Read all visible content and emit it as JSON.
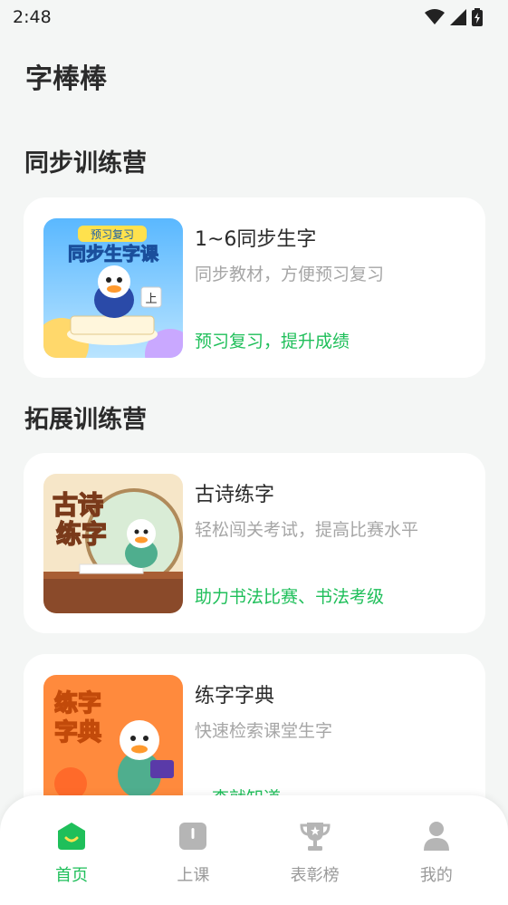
{
  "status_bar": {
    "time": "2:48"
  },
  "app": {
    "title": "字棒棒"
  },
  "sections": [
    {
      "title": "同步训练营"
    },
    {
      "title": "拓展训练营"
    }
  ],
  "cards": [
    {
      "title": "1~6同步生字",
      "subtitle": "同步教材，方便预习复习",
      "tag": "预习复习，提升成绩",
      "thumb_badge": "预习复习",
      "thumb_text": "同步生字课",
      "thumb_char": "上"
    },
    {
      "title": "古诗练字",
      "subtitle": "轻松闯关考试，提高比赛水平",
      "tag": "助力书法比赛、书法考级",
      "thumb_text_1": "古诗",
      "thumb_text_2": "练字"
    },
    {
      "title": "练字字典",
      "subtitle": "快速检索课堂生字",
      "tag": "一查就知道",
      "thumb_text_1": "练字",
      "thumb_text_2": "字典"
    }
  ],
  "tabbar": {
    "items": [
      {
        "label": "首页",
        "icon": "home-icon",
        "active": true
      },
      {
        "label": "上课",
        "icon": "book-icon",
        "active": false
      },
      {
        "label": "表彰榜",
        "icon": "trophy-icon",
        "active": false
      },
      {
        "label": "我的",
        "icon": "person-icon",
        "active": false
      }
    ]
  },
  "colors": {
    "accent": "#1fbf5a",
    "background": "#f4f6f5",
    "card": "#ffffff",
    "muted_text": "#a6a6a6"
  }
}
